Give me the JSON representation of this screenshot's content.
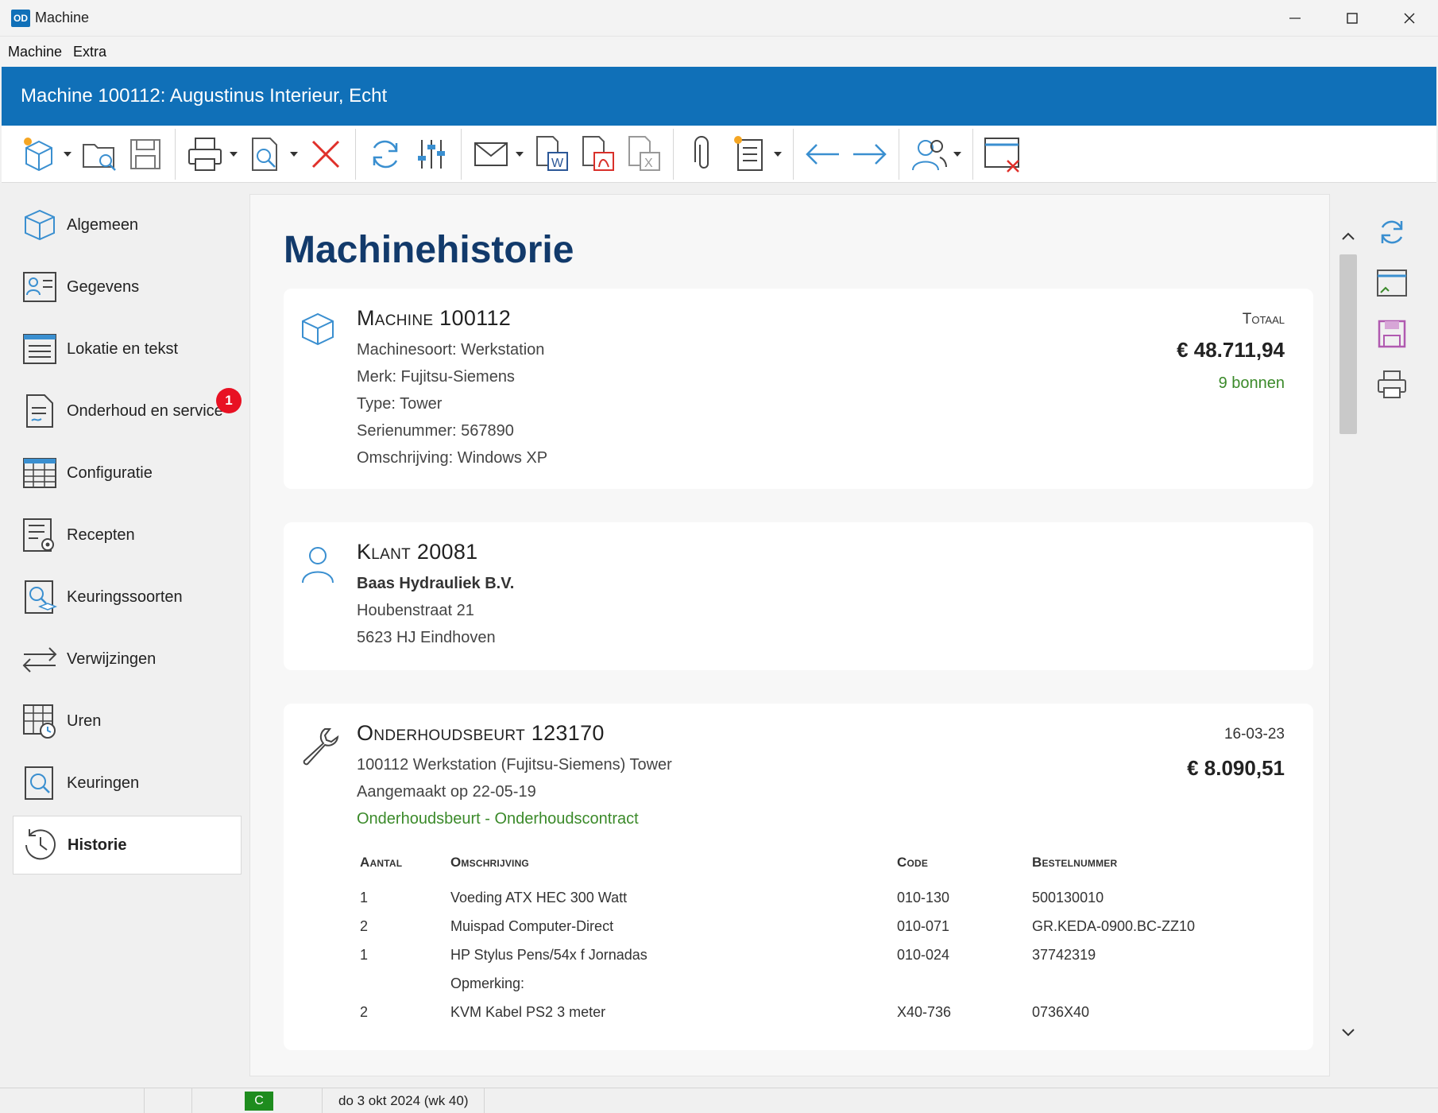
{
  "window": {
    "title": "Machine",
    "logo": "OD",
    "controls": [
      "minimize-icon",
      "maximize-icon",
      "close-icon"
    ]
  },
  "menu": {
    "items": [
      "Machine",
      "Extra"
    ]
  },
  "header": {
    "title": "Machine 100112: Augustinus Interieur, Echt"
  },
  "toolbar": {
    "icons": [
      "new-machine-icon",
      "open-icon",
      "save-icon",
      "print-icon",
      "preview-icon",
      "delete-icon",
      "refresh-icon",
      "settings-sliders-icon",
      "mail-icon",
      "word-export-icon",
      "pdf-export-icon",
      "excel-export-icon",
      "attachment-icon",
      "new-document-icon",
      "previous-icon",
      "next-icon",
      "users-icon",
      "close-window-icon"
    ]
  },
  "sidebar": {
    "items": [
      {
        "label": "Algemeen",
        "icon": "cube-icon"
      },
      {
        "label": "Gegevens",
        "icon": "contact-card-icon"
      },
      {
        "label": "Lokatie en tekst",
        "icon": "text-lines-icon"
      },
      {
        "label": "Onderhoud en service",
        "icon": "document-icon",
        "badge": "1"
      },
      {
        "label": "Configuratie",
        "icon": "grid-table-icon"
      },
      {
        "label": "Recepten",
        "icon": "list-gear-icon"
      },
      {
        "label": "Keuringssoorten",
        "icon": "inspection-types-icon"
      },
      {
        "label": "Verwijzingen",
        "icon": "arrows-exchange-icon"
      },
      {
        "label": "Uren",
        "icon": "calendar-clock-icon"
      },
      {
        "label": "Keuringen",
        "icon": "search-document-icon"
      },
      {
        "label": "Historie",
        "icon": "history-clock-icon",
        "active": true
      }
    ]
  },
  "main": {
    "title": "Machinehistorie",
    "machine_card": {
      "heading": "Machine 100112",
      "lines": [
        "Machinesoort: Werkstation",
        "Merk: Fujitsu-Siemens",
        "Type: Tower",
        "Serienummer: 567890",
        "Omschrijving: Windows XP"
      ],
      "total_label": "Totaal",
      "total_amount": "€ 48.711,94",
      "bonnen": "9 bonnen"
    },
    "client_card": {
      "heading": "Klant 20081",
      "name": "Baas Hydrauliek B.V.",
      "address1": "Houbenstraat 21",
      "address2": "5623 HJ Eindhoven"
    },
    "service_card": {
      "heading": "Onderhoudsbeurt 123170",
      "line1": "100112 Werkstation (Fujitsu-Siemens) Tower",
      "line2": "Aangemaakt op 22-05-19",
      "line3": "Onderhoudsbeurt - Onderhoudscontract",
      "date": "16-03-23",
      "amount": "€ 8.090,51",
      "table": {
        "headers": [
          "Aantal",
          "Omschrijving",
          "Code",
          "Bestelnummer"
        ],
        "rows": [
          [
            "1",
            "Voeding ATX HEC 300 Watt",
            "010-130",
            "500130010"
          ],
          [
            "2",
            "Muispad Computer-Direct",
            "010-071",
            "GR.KEDA-0900.BC-ZZ10"
          ],
          [
            "1",
            "HP Stylus Pens/54x f Jornadas",
            "010-024",
            "37742319"
          ],
          [
            "",
            "Opmerking:",
            "",
            ""
          ],
          [
            "2",
            "KVM Kabel PS2 3 meter",
            "X40-736",
            "0736X40"
          ]
        ]
      }
    }
  },
  "right_tools": [
    "refresh-icon",
    "window-check-icon",
    "save-icon",
    "print-icon"
  ],
  "statusbar": {
    "status_code": "C",
    "date": "do 3 okt 2024 (wk 40)"
  },
  "colors": {
    "accent": "#1070b8",
    "title_text": "#123a6b",
    "green_text": "#3b8a2a",
    "badge": "#e81123",
    "status_green": "#1e8c1e"
  }
}
